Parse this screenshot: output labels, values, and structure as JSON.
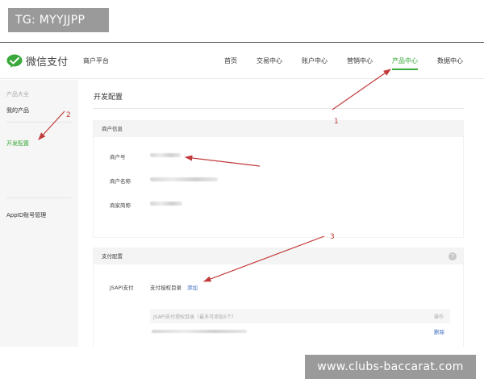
{
  "watermarks": {
    "top": "TG: MYYJJPP",
    "bottom": "www.clubs-baccarat.com"
  },
  "header": {
    "logo_text": "微信支付",
    "platform": "商户平台",
    "nav": [
      {
        "label": "首页",
        "active": false
      },
      {
        "label": "交易中心",
        "active": false
      },
      {
        "label": "账户中心",
        "active": false
      },
      {
        "label": "营销中心",
        "active": false
      },
      {
        "label": "产品中心",
        "active": true
      },
      {
        "label": "数据中心",
        "active": false
      }
    ]
  },
  "sidebar": {
    "group_label": "产品大全",
    "items": [
      {
        "label": "我的产品",
        "active": false
      },
      {
        "label": "开发配置",
        "active": true
      },
      {
        "label": "AppID账号管理",
        "active": false
      }
    ]
  },
  "main": {
    "title": "开发配置",
    "merchant_info": {
      "header": "商户信息",
      "fields": [
        {
          "label": "商户号"
        },
        {
          "label": "商户名称"
        },
        {
          "label": "商家简称"
        }
      ]
    },
    "payment_config": {
      "header": "支付配置",
      "help_glyph": "?",
      "jsapi_label": "JSAPI支付",
      "auth_dir_label": "支付授权目录",
      "add_link": "添加",
      "table_header": "JSAPI支付授权目录（最多可添加5个）",
      "action_header": "操作",
      "delete_link": "删除"
    }
  },
  "annotations": [
    "1",
    "2",
    "3"
  ],
  "colors": {
    "accent_green": "#3aa83a",
    "link_blue": "#3f6cc0",
    "arrow_red": "#c23a3a",
    "watermark_gray": "#9a9a9a"
  }
}
